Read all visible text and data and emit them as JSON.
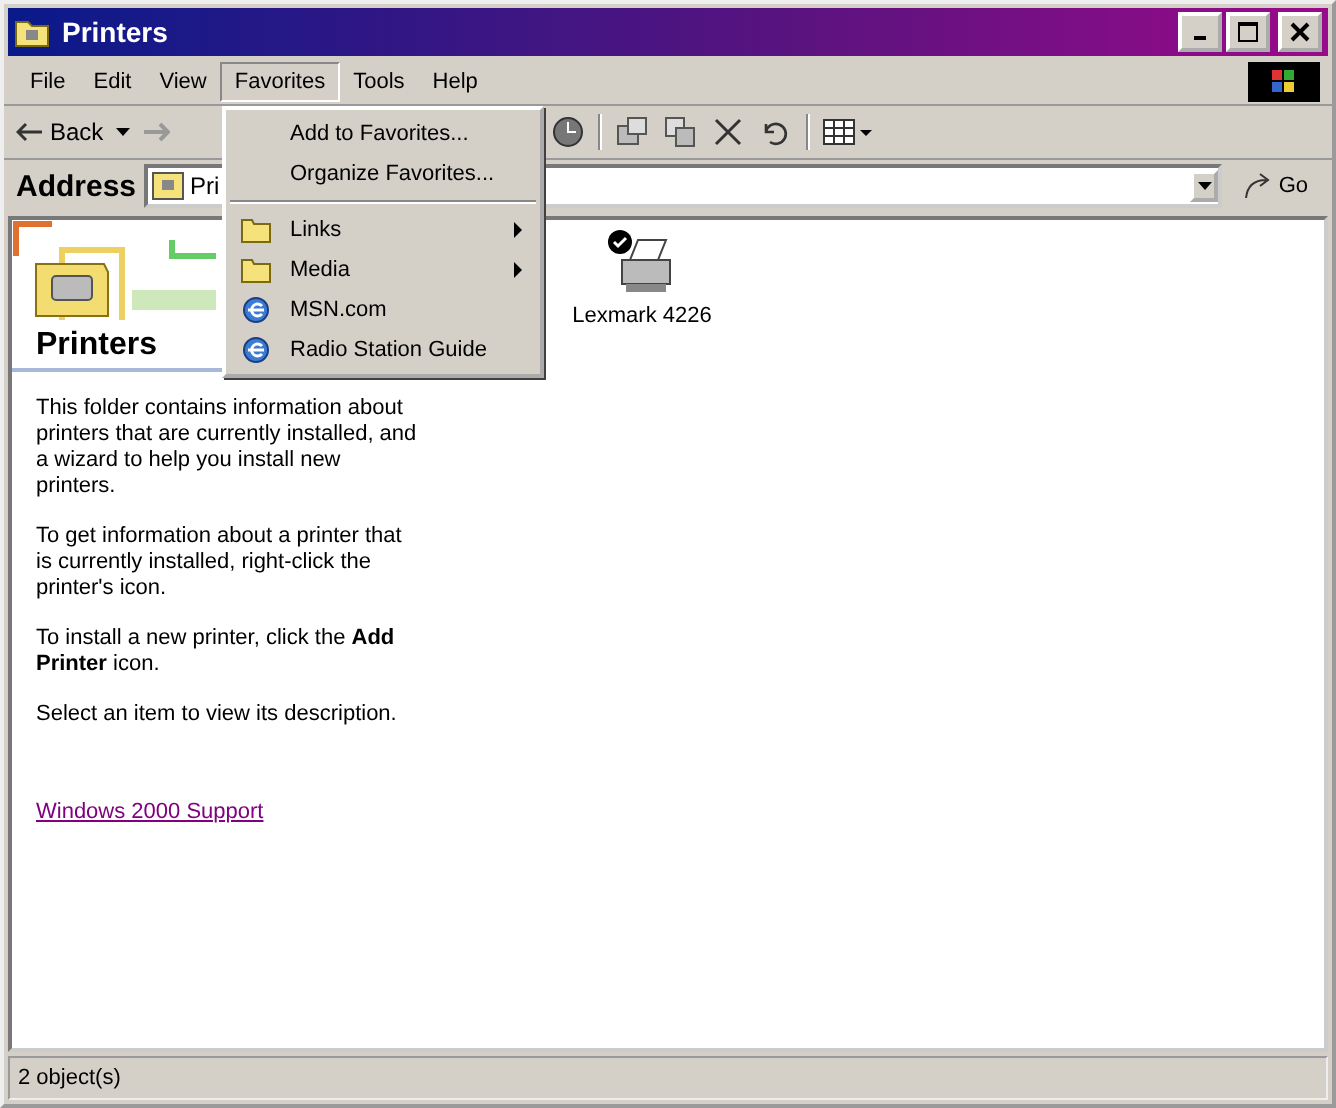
{
  "window": {
    "title": "Printers"
  },
  "menu": [
    {
      "label": "File",
      "selected": false
    },
    {
      "label": "Edit",
      "selected": false
    },
    {
      "label": "View",
      "selected": false
    },
    {
      "label": "Favorites",
      "selected": true
    },
    {
      "label": "Tools",
      "selected": false
    },
    {
      "label": "Help",
      "selected": false
    }
  ],
  "toolbar": {
    "back": "Back"
  },
  "address": {
    "label": "Address",
    "value": "Pri",
    "go": "Go"
  },
  "dropdown": [
    {
      "kind": "item",
      "label": "Add to Favorites..."
    },
    {
      "kind": "item",
      "label": "Organize Favorites..."
    },
    {
      "kind": "separator"
    },
    {
      "kind": "folder",
      "label": "Links",
      "submenu": true
    },
    {
      "kind": "folder",
      "label": "Media",
      "submenu": true
    },
    {
      "kind": "link",
      "label": "MSN.com",
      "submenu": false
    },
    {
      "kind": "link",
      "label": "Radio Station Guide",
      "submenu": false
    }
  ],
  "panel": {
    "title": "Printers",
    "paragraphs": [
      "This folder contains information about printers that are currently installed, and a wizard to help you install new printers.",
      "To get information about a printer that is currently installed, right-click the printer's icon.",
      "To install a new printer, click the **Add Printer** icon.",
      "Select an item to view its description."
    ],
    "link": "Windows 2000 Support"
  },
  "items": [
    {
      "label": "Lexmark 4226",
      "default": true
    }
  ],
  "status_bar": "2 object(s)"
}
